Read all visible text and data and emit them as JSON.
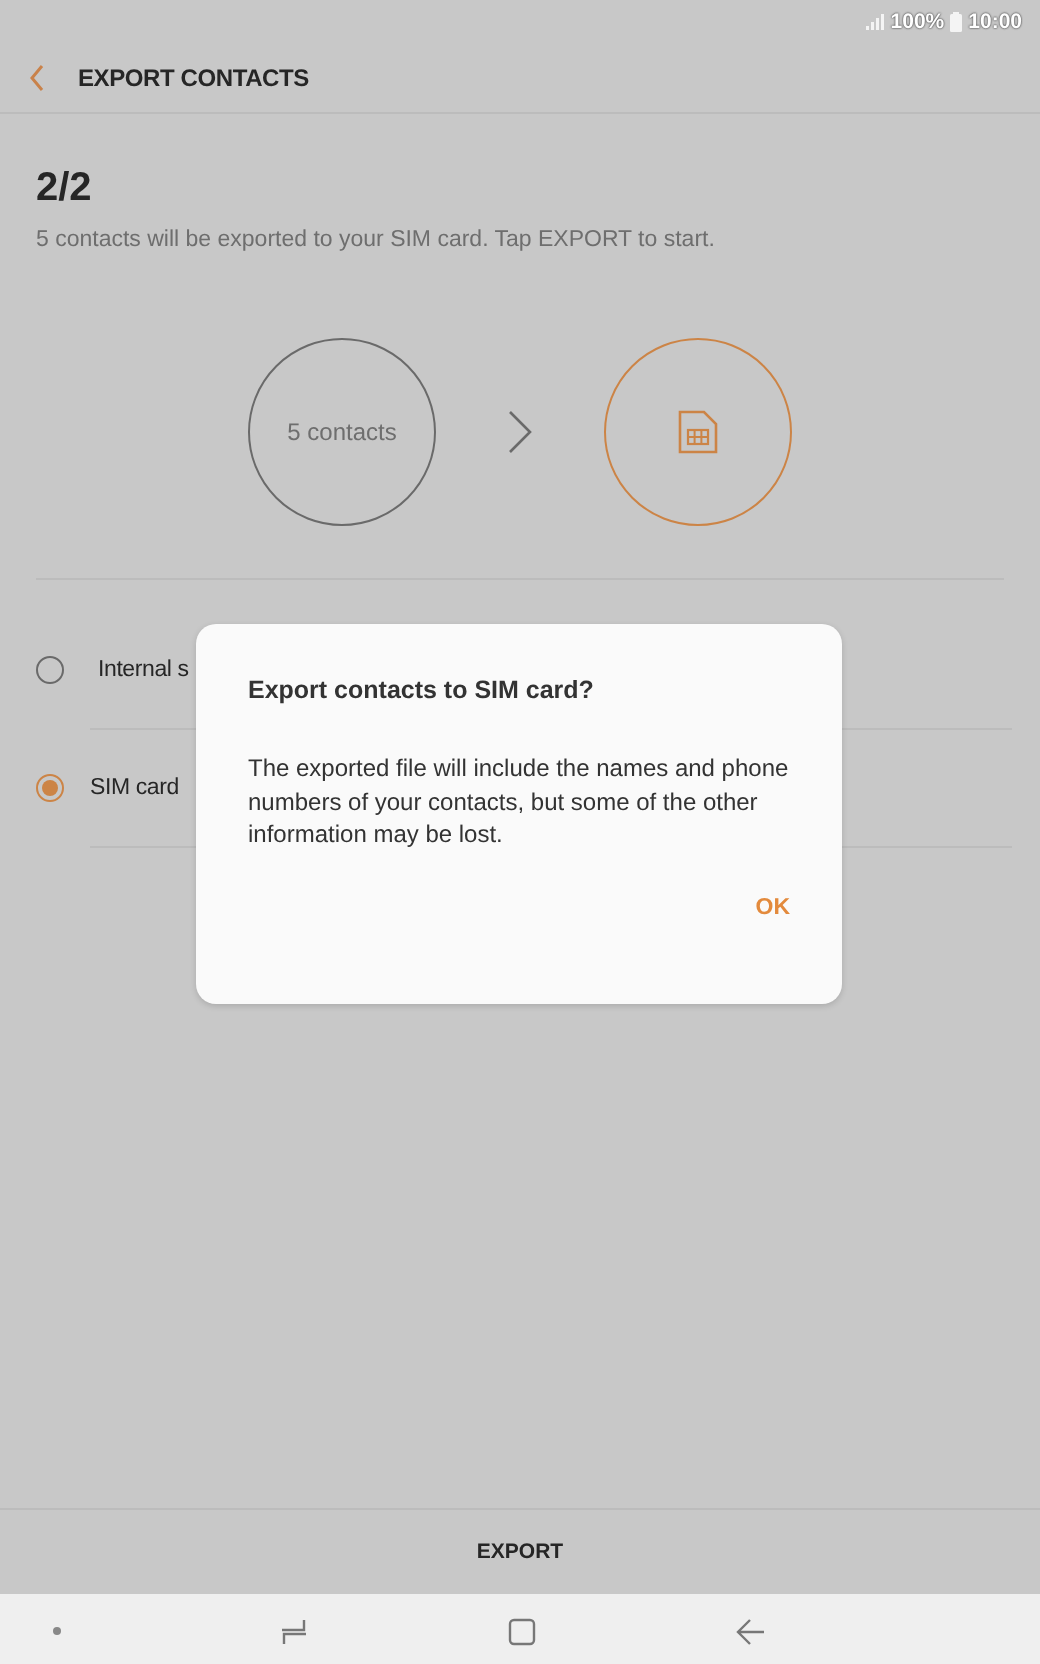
{
  "status_bar": {
    "battery": "100%",
    "time": "10:00"
  },
  "header": {
    "title": "EXPORT CONTACTS"
  },
  "step": {
    "counter": "2/2",
    "description": "5 contacts will be exported to your SIM card. Tap EXPORT to start."
  },
  "flow": {
    "source": "5 contacts"
  },
  "options": [
    {
      "label": "Internal s",
      "selected": false
    },
    {
      "label": "SIM card",
      "selected": true
    }
  ],
  "dialog": {
    "title": "Export contacts to SIM card?",
    "message": "The exported file will include the names and phone numbers of your contacts, but some of the other information may be lost.",
    "button": "OK"
  },
  "bottom_button": "EXPORT"
}
